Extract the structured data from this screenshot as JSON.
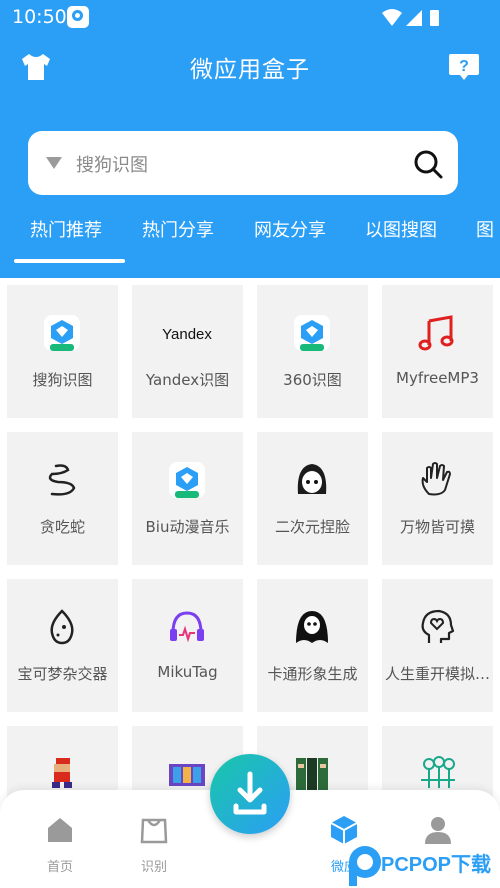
{
  "status_bar": {
    "time": "10:50"
  },
  "header": {
    "title": "微应用盒子"
  },
  "search": {
    "placeholder": "搜狗识图"
  },
  "tabs": [
    {
      "label": "热门推荐"
    },
    {
      "label": "热门分享"
    },
    {
      "label": "网友分享"
    },
    {
      "label": "以图搜图"
    },
    {
      "label": "图"
    }
  ],
  "apps": [
    {
      "label": "搜狗识图",
      "icon": "sogou-plus-icon"
    },
    {
      "label": "Yandex识图",
      "icon": "yandex-logo-icon"
    },
    {
      "label": "360识图",
      "icon": "360-plus-icon"
    },
    {
      "label": "MyfreeMP3",
      "icon": "music-note-icon"
    },
    {
      "label": "贪吃蛇",
      "icon": "snake-icon"
    },
    {
      "label": "Biu动漫音乐",
      "icon": "biu-plus-icon"
    },
    {
      "label": "二次元捏脸",
      "icon": "anime-face-icon"
    },
    {
      "label": "万物皆可摸",
      "icon": "hand-icon"
    },
    {
      "label": "宝可梦杂交器",
      "icon": "egg-icon"
    },
    {
      "label": "MikuTag",
      "icon": "headphones-icon"
    },
    {
      "label": "卡通形象生成",
      "icon": "ghost-icon"
    },
    {
      "label": "人生重开模拟…",
      "icon": "head-heart-icon"
    },
    {
      "label": "",
      "icon": "pixel-mario-icon"
    },
    {
      "label": "",
      "icon": "film-icon"
    },
    {
      "label": "",
      "icon": "pixel-people-icon"
    },
    {
      "label": "",
      "icon": "tree-fence-icon"
    }
  ],
  "bottom_nav": [
    {
      "label": "首页",
      "icon": "home-icon"
    },
    {
      "label": "识别",
      "icon": "bag-icon"
    },
    {
      "label": "微应",
      "icon": "box-icon"
    },
    {
      "label": "",
      "icon": "user-icon"
    }
  ],
  "watermark": {
    "text": "PCPOP下载"
  },
  "colors": {
    "primary": "#2b9ef6",
    "card": "#f2f2f2",
    "active": "#2b9ef6"
  }
}
